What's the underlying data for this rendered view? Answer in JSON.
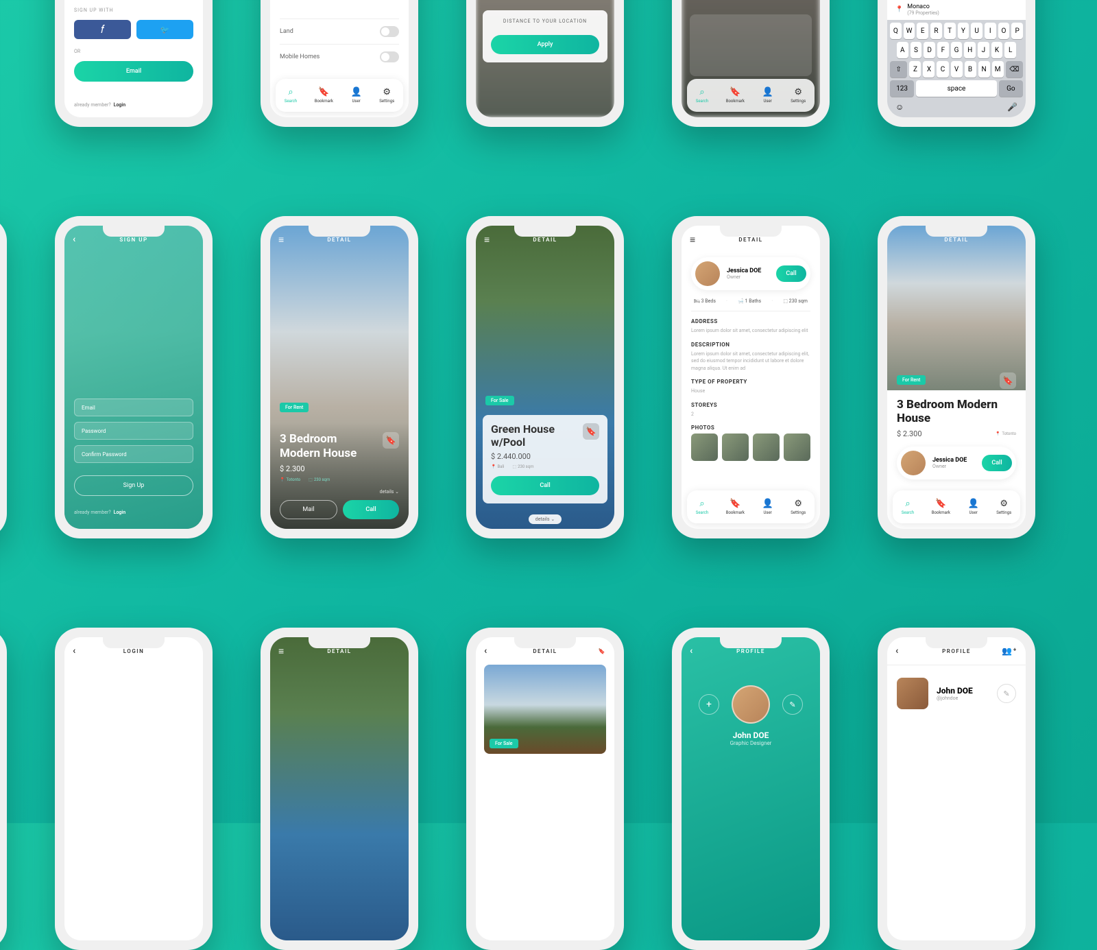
{
  "colors": {
    "accent": "#1bc9a8",
    "facebook": "#3b5998",
    "twitter": "#1da1f2"
  },
  "tabbar": {
    "search": "Search",
    "bookmark": "Bookmark",
    "user": "User",
    "settings": "Settings"
  },
  "row1": {
    "signup_social": {
      "signup_with": "SIGN UP WITH",
      "or": "OR",
      "email_btn": "Email",
      "already": "already member?",
      "login": "Login"
    },
    "filters": {
      "land": "Land",
      "mobile": "Mobile Homes"
    },
    "distance": {
      "label": "DISTANCE TO YOUR LOCATION",
      "apply": "Apply"
    },
    "keyboard": {
      "monaco": "Monaco",
      "monaco_sub": "(79 Properties)",
      "row1": [
        "Q",
        "W",
        "E",
        "R",
        "T",
        "Y",
        "U",
        "I",
        "O",
        "P"
      ],
      "row2": [
        "A",
        "S",
        "D",
        "F",
        "G",
        "H",
        "J",
        "K",
        "L"
      ],
      "row3": [
        "Z",
        "X",
        "C",
        "V",
        "B",
        "N",
        "M"
      ],
      "num": "123",
      "space": "space",
      "go": "Go"
    }
  },
  "row2": {
    "signup": {
      "title": "SIGN UP",
      "email": "Email",
      "password": "Password",
      "confirm": "Confirm Password",
      "btn": "Sign Up",
      "already": "already member?",
      "login": "Login"
    },
    "detail1": {
      "title": "DETAIL",
      "badge": "For Rent",
      "name": "3 Bedroom Modern House",
      "price": "$ 2.300",
      "loc": "Totonto",
      "area": "230 sqm",
      "details_link": "details",
      "mail_btn": "Mail",
      "call_btn": "Call"
    },
    "detail2": {
      "title": "DETAIL",
      "badge": "For Sale",
      "name": "Green House w/Pool",
      "price": "$ 2.440.000",
      "loc": "Bali",
      "area": "230 sqm",
      "call_btn": "Call",
      "details_link": "details"
    },
    "detail3": {
      "title": "DETAIL",
      "owner_name": "Jessica DOE",
      "owner_role": "Owner",
      "call_btn": "Call",
      "beds": "3 Beds",
      "baths": "1 Baths",
      "area": "230 sqm",
      "address_h": "ADDRESS",
      "address": "Lorem ipsum dolor sit amet, consectetur adipiscing elit",
      "desc_h": "DESCRIPTION",
      "desc": "Lorem ipsum dolor sit amet, consectetur adipiscing elit, sed do eiusmod tempor incididunt ut labore et dolore magna aliqua. Ut enim ad",
      "type_h": "TYPE OF PROPERTY",
      "type": "House",
      "storeys_h": "STOREYS",
      "storeys": "2",
      "photos_h": "PHOTOS"
    },
    "detail4": {
      "title": "DETAIL",
      "badge": "For Rent",
      "name": "3 Bedroom Modern House",
      "price": "$ 2.300",
      "loc": "Totonto",
      "owner_name": "Jessica DOE",
      "owner_role": "Owner",
      "call_btn": "Call"
    }
  },
  "row3": {
    "login": {
      "title": "LOGIN"
    },
    "detail_green": {
      "title": "DETAIL"
    },
    "detail_house": {
      "title": "DETAIL",
      "badge": "For Sale"
    },
    "profile1": {
      "title": "PROFILE",
      "name": "John DOE",
      "role": "Graphic Designer"
    },
    "profile2": {
      "title": "PROFILE",
      "name": "John DOE",
      "handle": "@johndoe"
    }
  }
}
